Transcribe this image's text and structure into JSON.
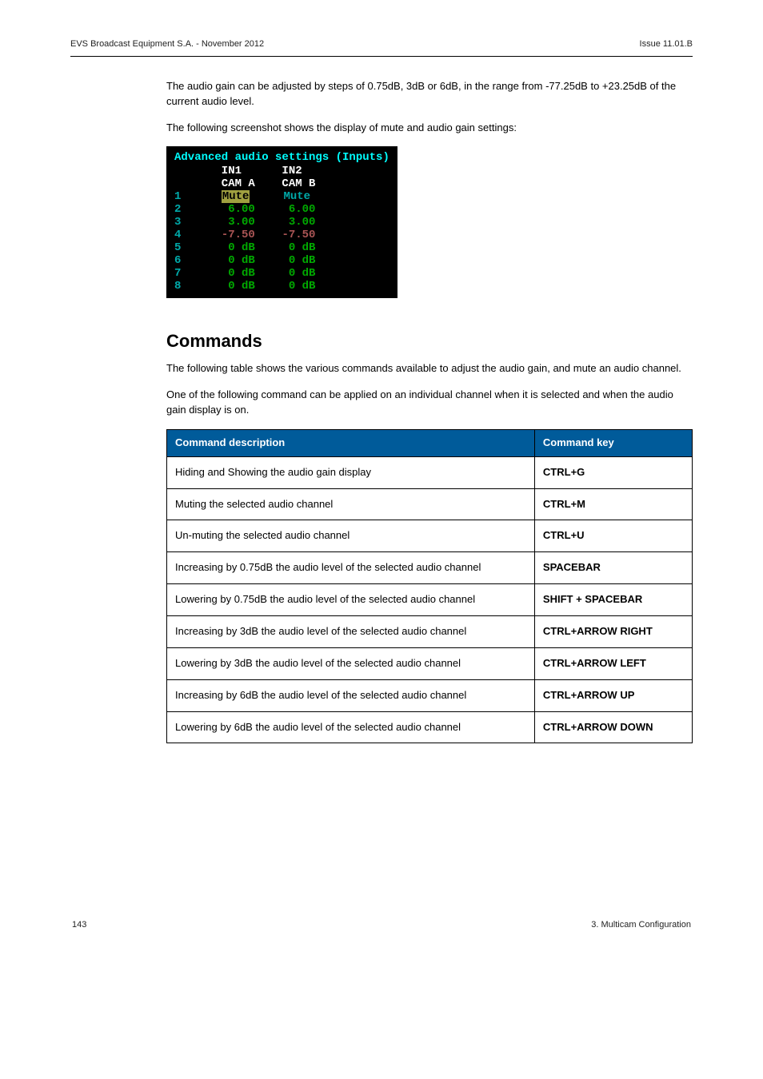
{
  "header": {
    "left": "EVS Broadcast Equipment S.A. - November 2012",
    "right": "Issue 11.01.B"
  },
  "intro": {
    "p1": "The audio gain can be adjusted by steps of 0.75dB, 3dB or 6dB, in the range from -77.25dB to +23.25dB of the current audio level.",
    "p2": "The following screenshot shows the display of mute and audio gain settings:"
  },
  "terminal": {
    "title": "Advanced audio settings (Inputs)",
    "head1": "       IN1      IN2",
    "head2": "       CAM A    CAM B",
    "rows": [
      {
        "idx": "1",
        "left": "Mute",
        "leftClass": "t-yellow-hl",
        "right": "Mute",
        "rightClass": "t-cyan"
      },
      {
        "idx": "2",
        "left": " 6.00",
        "leftClass": "t-green",
        "right": " 6.00",
        "rightClass": "t-green"
      },
      {
        "idx": "3",
        "left": " 3.00",
        "leftClass": "t-green",
        "right": " 3.00",
        "rightClass": "t-green"
      },
      {
        "idx": "4",
        "left": "-7.50",
        "leftClass": "t-red",
        "right": "-7.50",
        "rightClass": "t-red"
      },
      {
        "idx": "5",
        "left": " 0 dB",
        "leftClass": "t-green",
        "right": " 0 dB",
        "rightClass": "t-green"
      },
      {
        "idx": "6",
        "left": " 0 dB",
        "leftClass": "t-green",
        "right": " 0 dB",
        "rightClass": "t-green"
      },
      {
        "idx": "7",
        "left": " 0 dB",
        "leftClass": "t-green",
        "right": " 0 dB",
        "rightClass": "t-green"
      },
      {
        "idx": "8",
        "left": " 0 dB",
        "leftClass": "t-green",
        "right": " 0 dB",
        "rightClass": "t-green"
      }
    ]
  },
  "section": {
    "heading": "Commands",
    "p1": "The following table shows the various commands available to adjust the audio gain, and mute an audio channel.",
    "p2": "One of the following command can be applied on an individual channel when it is selected and when the audio gain display is on."
  },
  "table": {
    "h1": "Command description",
    "h2": "Command key",
    "rows": [
      {
        "desc": "Hiding and Showing the audio gain display",
        "key": "CTRL+G"
      },
      {
        "desc": "Muting the selected audio channel",
        "key": "CTRL+M"
      },
      {
        "desc": "Un-muting the selected audio channel",
        "key": "CTRL+U"
      },
      {
        "desc": "Increasing by 0.75dB the audio level of the selected audio channel",
        "key": "SPACEBAR"
      },
      {
        "desc": "Lowering by 0.75dB the audio level of the selected audio channel",
        "key": "SHIFT + SPACEBAR"
      },
      {
        "desc": "Increasing by 3dB the audio level of the selected audio channel",
        "key": "CTRL+ARROW RIGHT"
      },
      {
        "desc": "Lowering by 3dB the audio level of the selected audio channel",
        "key": "CTRL+ARROW LEFT"
      },
      {
        "desc": "Increasing by 6dB the audio level of the selected audio channel",
        "key": "CTRL+ARROW UP"
      },
      {
        "desc": "Lowering by 6dB the audio level of the selected audio channel",
        "key": "CTRL+ARROW DOWN"
      }
    ]
  },
  "footer": {
    "left": "143",
    "right": "3. Multicam Configuration"
  }
}
